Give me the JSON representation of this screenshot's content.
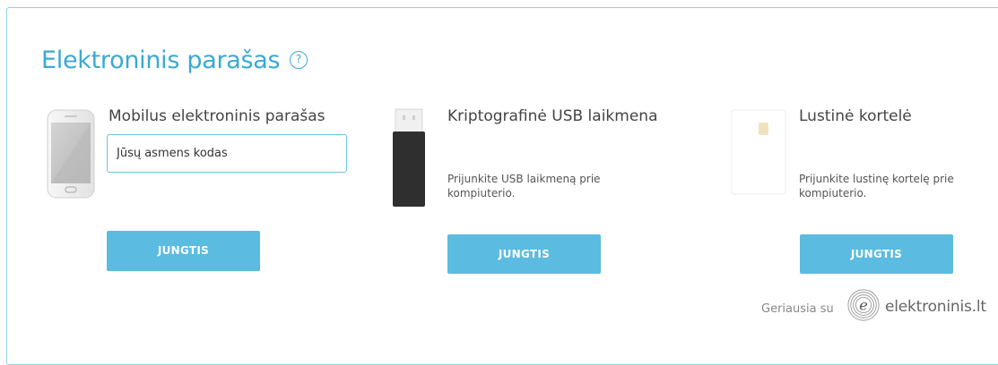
{
  "title": "Elektroninis parašas",
  "help_glyph": "?",
  "mobile": {
    "title": "Mobilus elektroninis parašas",
    "placeholder": "Jūsų asmens kodas",
    "button": "JUNGTIS",
    "icon": "smartphone-icon"
  },
  "usb": {
    "title": "Kriptografinė USB laikmena",
    "desc": "Prijunkite USB laikmeną prie kompiuterio.",
    "button": "JUNGTIS",
    "icon": "usb-token-icon"
  },
  "card": {
    "title": "Lustinė kortelė",
    "desc": "Prijunkite lustinę kortelę prie kompiuterio.",
    "button": "JUNGTIS",
    "icon": "smart-card-icon"
  },
  "footer": {
    "prefix": "Geriausia su",
    "brand": "elektroninis.lt"
  },
  "colors": {
    "accent": "#3aa9d3",
    "button": "#5bbbe0",
    "border": "#8fd0e6"
  }
}
